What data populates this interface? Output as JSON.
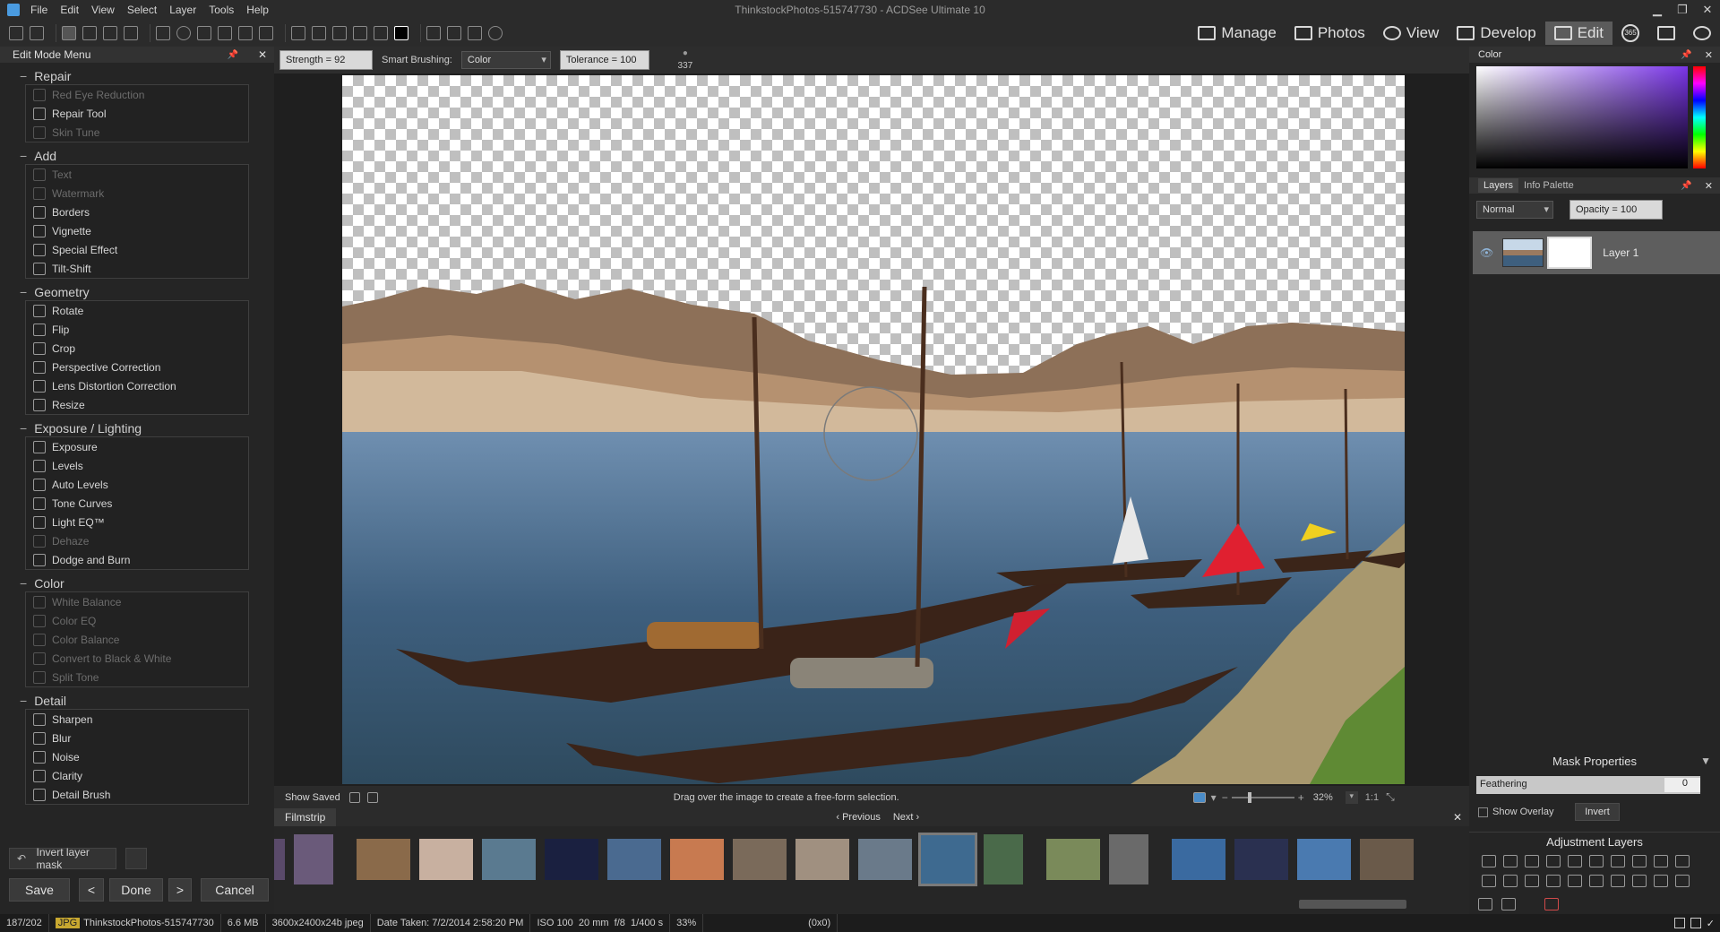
{
  "window": {
    "title": "ThinkstockPhotos-515747730 - ACDSee Ultimate 10",
    "menus": [
      "File",
      "Edit",
      "View",
      "Select",
      "Layer",
      "Tools",
      "Help"
    ],
    "controls": [
      "▁",
      "❐",
      "✕"
    ]
  },
  "modes": [
    {
      "label": "Manage",
      "icon": "grid-icon"
    },
    {
      "label": "Photos",
      "icon": "photos-icon"
    },
    {
      "label": "View",
      "icon": "eye-icon"
    },
    {
      "label": "Develop",
      "icon": "develop-icon"
    },
    {
      "label": "Edit",
      "icon": "edit-icon"
    }
  ],
  "mode_extra": {
    "badge": "365"
  },
  "left_panel": {
    "title": "Edit Mode Menu",
    "groups": [
      {
        "name": "Repair",
        "items": [
          {
            "label": "Red Eye Reduction",
            "enabled": false
          },
          {
            "label": "Repair Tool",
            "enabled": true
          },
          {
            "label": "Skin Tune",
            "enabled": false
          }
        ]
      },
      {
        "name": "Add",
        "items": [
          {
            "label": "Text",
            "enabled": false
          },
          {
            "label": "Watermark",
            "enabled": false
          },
          {
            "label": "Borders",
            "enabled": true
          },
          {
            "label": "Vignette",
            "enabled": true
          },
          {
            "label": "Special Effect",
            "enabled": true
          },
          {
            "label": "Tilt-Shift",
            "enabled": true
          }
        ]
      },
      {
        "name": "Geometry",
        "items": [
          {
            "label": "Rotate",
            "enabled": true
          },
          {
            "label": "Flip",
            "enabled": true
          },
          {
            "label": "Crop",
            "enabled": true
          },
          {
            "label": "Perspective Correction",
            "enabled": true
          },
          {
            "label": "Lens Distortion Correction",
            "enabled": true
          },
          {
            "label": "Resize",
            "enabled": true
          }
        ]
      },
      {
        "name": "Exposure / Lighting",
        "items": [
          {
            "label": "Exposure",
            "enabled": true
          },
          {
            "label": "Levels",
            "enabled": true
          },
          {
            "label": "Auto Levels",
            "enabled": true
          },
          {
            "label": "Tone Curves",
            "enabled": true
          },
          {
            "label": "Light EQ™",
            "enabled": true
          },
          {
            "label": "Dehaze",
            "enabled": false
          },
          {
            "label": "Dodge and Burn",
            "enabled": true
          }
        ]
      },
      {
        "name": "Color",
        "items": [
          {
            "label": "White Balance",
            "enabled": false
          },
          {
            "label": "Color EQ",
            "enabled": false
          },
          {
            "label": "Color Balance",
            "enabled": false
          },
          {
            "label": "Convert to Black & White",
            "enabled": false
          },
          {
            "label": "Split Tone",
            "enabled": false
          }
        ]
      },
      {
        "name": "Detail",
        "items": [
          {
            "label": "Sharpen",
            "enabled": true
          },
          {
            "label": "Blur",
            "enabled": true
          },
          {
            "label": "Noise",
            "enabled": true
          },
          {
            "label": "Clarity",
            "enabled": true
          },
          {
            "label": "Detail Brush",
            "enabled": true
          }
        ]
      }
    ],
    "invert_label": "Invert layer mask",
    "save_label": "Save",
    "done_label": "Done",
    "cancel_label": "Cancel"
  },
  "options": {
    "strength": "Strength = 92",
    "smart_label": "Smart Brushing:",
    "smart_value": "Color",
    "tolerance": "Tolerance = 100",
    "brush_size": "337"
  },
  "canvas_status": {
    "show_saved": "Show Saved",
    "hint": "Drag over the image to create a free-form selection.",
    "zoom": "32%",
    "ratio": "1:1"
  },
  "filmstrip": {
    "title": "Filmstrip",
    "prev": "Previous",
    "next": "Next"
  },
  "right_panel": {
    "color_title": "Color",
    "layers_tab": "Layers",
    "info_tab": "Info Palette",
    "blend": "Normal",
    "opacity": "Opacity = 100",
    "layer_name": "Layer 1",
    "mask_title": "Mask Properties",
    "feathering_label": "Feathering",
    "feathering_value": "0",
    "show_overlay": "Show Overlay",
    "invert": "Invert",
    "adjust_title": "Adjustment Layers"
  },
  "status": {
    "index": "187/202",
    "type": "JPG",
    "filename": "ThinkstockPhotos-515747730",
    "size": "6.6 MB",
    "dims": "3600x2400x24b jpeg",
    "date": "Date Taken: 7/2/2014 2:58:20 PM",
    "iso": "ISO 100",
    "focal": "20 mm",
    "fstop": "f/8",
    "shutter": "1/400 s",
    "zoom": "33%",
    "coords": "(0x0)"
  }
}
